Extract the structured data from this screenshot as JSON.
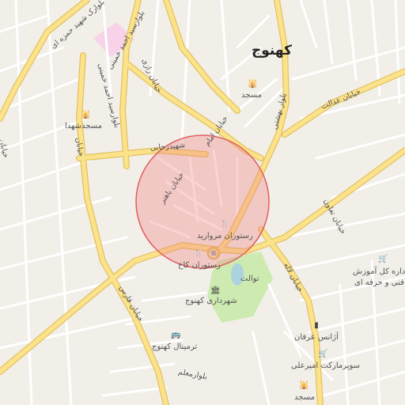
{
  "city_label": "کهنوج",
  "roads": [
    {
      "id": "r1",
      "text": "بلوارسید احمد خمینی"
    },
    {
      "id": "r2",
      "text": "خیابان رازی"
    },
    {
      "id": "r3",
      "text": "بلوار شهید حمزه ای"
    },
    {
      "id": "r4",
      "text": "خیابان امام"
    },
    {
      "id": "r5",
      "text": "بلوار بهشتی"
    },
    {
      "id": "r6",
      "text": "خیابان عدالت"
    },
    {
      "id": "r7",
      "text": "شهیدرجایی"
    },
    {
      "id": "r8",
      "text": "خیابان باهنر"
    },
    {
      "id": "r9",
      "text": "خیابان تعاون"
    },
    {
      "id": "r10",
      "text": "خیابان لاله"
    },
    {
      "id": "r11",
      "text": "بلوارمعلم"
    },
    {
      "id": "r12",
      "text": "خیابان فارس"
    },
    {
      "id": "r13",
      "text": "بلوارک شهید حمزه ای"
    },
    {
      "id": "r14",
      "text": "خیابان"
    },
    {
      "id": "r15",
      "text": "خیابان"
    }
  ],
  "pois": [
    {
      "id": "p1",
      "text": "مسجد",
      "icon": "mosque-icon",
      "glyph": "🕌"
    },
    {
      "id": "p2",
      "text": "مسجدشهدا",
      "icon": "mosque-icon",
      "glyph": "🕌"
    },
    {
      "id": "p3",
      "text": "رستوران مروارید",
      "icon": "restaurant-icon",
      "glyph": "🍴"
    },
    {
      "id": "p4",
      "text": "رستوران کاخ",
      "icon": "restaurant-icon",
      "glyph": "🍴"
    },
    {
      "id": "p5",
      "text": "توالت",
      "icon": "toilet-icon",
      "glyph": ""
    },
    {
      "id": "p6",
      "text": "شهرداری کهنوج",
      "icon": "townhall-icon",
      "glyph": "🏛"
    },
    {
      "id": "p7",
      "text": "ترمینال کهنوج",
      "icon": "bus-icon",
      "glyph": "🚌"
    },
    {
      "id": "p8",
      "text": "آژانس عرفان",
      "icon": "taxi-icon",
      "glyph": "▮"
    },
    {
      "id": "p9",
      "text": "سوپرمارکت امیرعلی",
      "icon": "shop-icon",
      "glyph": "🛒"
    },
    {
      "id": "p10",
      "text": "مسجد",
      "icon": "mosque-icon",
      "glyph": "🕌"
    },
    {
      "id": "p11",
      "text": "اداره کل آموزش فنی و حرفه ای",
      "line1": "اداره کل آموزش",
      "line2": "فنی و حرفه ای",
      "icon": "school-icon",
      "glyph": "🛒"
    }
  ],
  "colors": {
    "background": "#f2efe9",
    "road": "#fbe38b",
    "road_casing": "#e4c160",
    "minor_road": "#ffffff",
    "park": "#cdebb0",
    "pink_area": "#f7d2e8",
    "water": "#aad3df",
    "highlight_fill": "#f08080",
    "highlight_stroke": "#e06060"
  }
}
